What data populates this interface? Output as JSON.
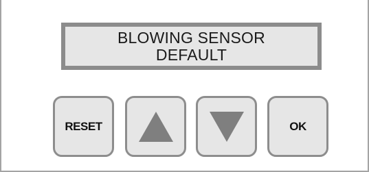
{
  "display": {
    "line1": "BLOWING SENSOR",
    "line2": "DEFAULT"
  },
  "buttons": {
    "reset_label": "RESET",
    "ok_label": "OK",
    "up_icon": "triangle-up-icon",
    "down_icon": "triangle-down-icon"
  },
  "colors": {
    "lcd_background": "#e6e6e6",
    "frame_border": "#8c8c8c",
    "arrow_fill": "#7f7f7f"
  }
}
